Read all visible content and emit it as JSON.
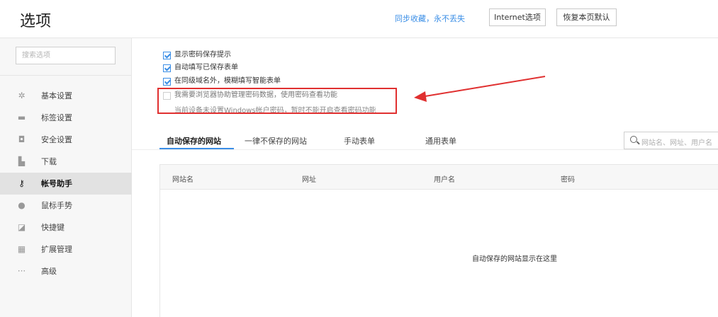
{
  "header": {
    "title": "选项",
    "sync_link": "同步收藏，永不丢失",
    "internet_button": "Internet选项",
    "restore_button": "恢复本页默认"
  },
  "sidebar": {
    "search_placeholder": "搜索选项",
    "items": [
      {
        "label": "基本设置",
        "icon": "gear-icon",
        "active": false
      },
      {
        "label": "标签设置",
        "icon": "tab-icon",
        "active": false
      },
      {
        "label": "安全设置",
        "icon": "shield-icon",
        "active": false
      },
      {
        "label": "下载",
        "icon": "download-icon",
        "active": false
      },
      {
        "label": "帐号助手",
        "icon": "key-icon",
        "active": true
      },
      {
        "label": "鼠标手势",
        "icon": "mouse-icon",
        "active": false
      },
      {
        "label": "快捷键",
        "icon": "shortcut-icon",
        "active": false
      },
      {
        "label": "扩展管理",
        "icon": "extensions-icon",
        "active": false
      },
      {
        "label": "高级",
        "icon": "more-icon",
        "active": false
      }
    ]
  },
  "options": {
    "show_password_prompt": "显示密码保存提示",
    "autofill_saved_forms": "自动填写已保存表单",
    "fuzzy_fill_forms": "在同级域名外，模糊填写智能表单",
    "browser_manage_passwords": "我需要浏览器协助管理密码数据，使用密码查看功能",
    "windows_password_note": "当前设备未设置Windows帐户密码，暂时不能开启查看密码功能"
  },
  "tabs": {
    "auto_saved": "自动保存的网站",
    "never_saved": "一律不保存的网站",
    "manual_forms": "手动表单",
    "general_forms": "通用表单"
  },
  "site_search_placeholder": "网站名、网址、用户名",
  "table": {
    "columns": [
      "网站名",
      "网址",
      "用户名",
      "密码"
    ],
    "empty_message": "自动保存的网站显示在这里"
  },
  "colors": {
    "accent": "#3a8ee6",
    "highlight": "#e03030"
  }
}
